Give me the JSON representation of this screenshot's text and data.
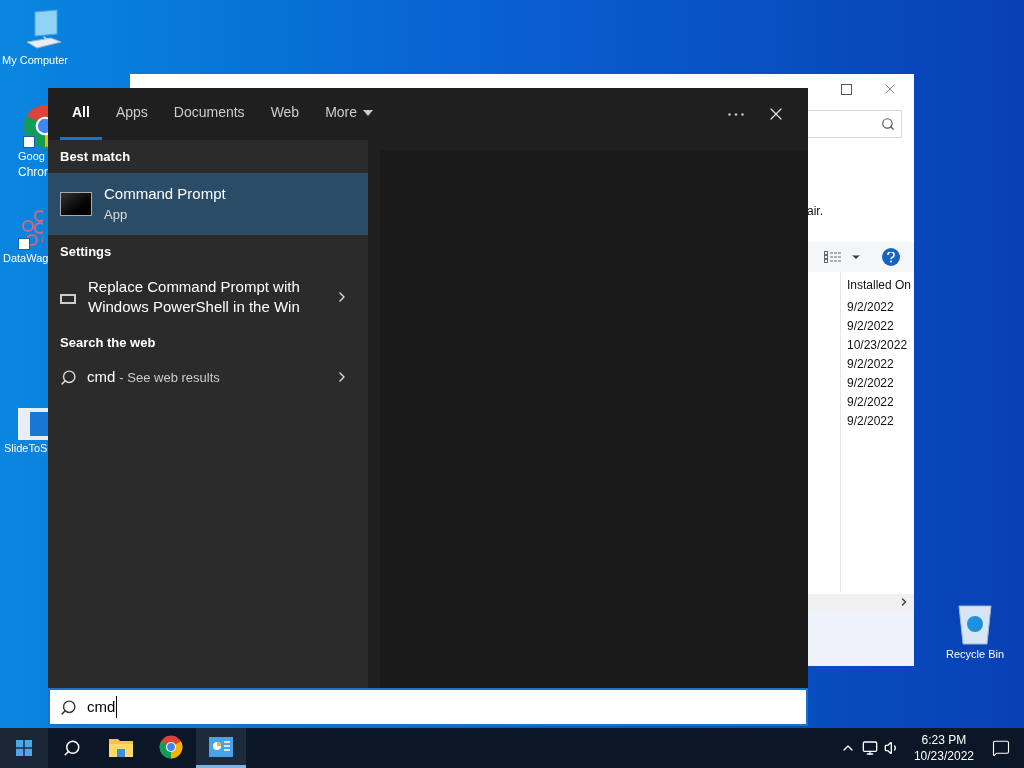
{
  "desktop_icons": [
    {
      "kind": "computer",
      "label": "My Computer"
    },
    {
      "kind": "chrome",
      "label": "Goog",
      "label_2": "Chron"
    },
    {
      "kind": "molecule-shortcut",
      "label": "DataWag"
    },
    {
      "kind": "slide",
      "label": "SlideToS"
    },
    {
      "kind": "recycle",
      "label": "Recycle Bin"
    }
  ],
  "background_window": {
    "text_fragment": "air.",
    "column_header": "Installed On",
    "dates": [
      "9/2/2022",
      "9/2/2022",
      "10/23/2022",
      "9/2/2022",
      "9/2/2022",
      "9/2/2022",
      "9/2/2022"
    ]
  },
  "search_panel": {
    "tabs": [
      {
        "label": "All",
        "selected": true,
        "kind": "tab"
      },
      {
        "label": "Apps",
        "selected": false,
        "kind": "tab"
      },
      {
        "label": "Documents",
        "selected": false,
        "kind": "tab"
      },
      {
        "label": "Web",
        "selected": false,
        "kind": "tab"
      },
      {
        "label": "More",
        "selected": false,
        "kind": "menu"
      }
    ],
    "sections": [
      {
        "heading": "Best match",
        "items": [
          {
            "kind": "app",
            "title": "Command Prompt",
            "subtitle": "App",
            "selected": true
          }
        ]
      },
      {
        "heading": "Settings",
        "items": [
          {
            "kind": "setting",
            "title": "Replace Command Prompt with Windows PowerShell in the Win",
            "selected": false
          }
        ]
      },
      {
        "heading": "Search the web",
        "items": [
          {
            "kind": "web",
            "title": "cmd",
            "subtitle": "- See web results",
            "selected": false
          }
        ]
      }
    ],
    "query": "cmd"
  },
  "taskbar": {
    "apps": [
      {
        "kind": "explorer",
        "active": false
      },
      {
        "kind": "chrome",
        "active": false
      },
      {
        "kind": "control-panel",
        "active": true
      }
    ],
    "time": "6:23 PM",
    "date": "10/23/2022"
  }
}
